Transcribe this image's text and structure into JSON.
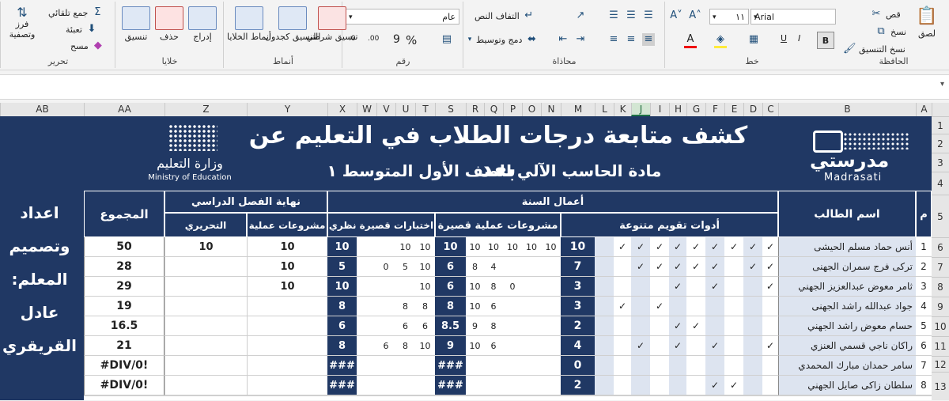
{
  "ribbon": {
    "clipboard": {
      "label": "الحافظة",
      "paste": "لصق",
      "cut": "قص",
      "copy": "نسخ",
      "format_painter": "نسخ التنسيق"
    },
    "font": {
      "label": "خط",
      "name": "Arial",
      "size": "١١",
      "bold": "B",
      "italic": "I",
      "underline": "U"
    },
    "alignment": {
      "label": "محاذاة",
      "wrap": "التفاف النص",
      "merge": "دمج وتوسيط"
    },
    "number": {
      "label": "رقم",
      "format": "عام",
      "percent": "%",
      "comma": "9",
      "inc_dec": ".00",
      "dec_dec": ".0"
    },
    "styles": {
      "label": "أنماط",
      "conditional": "تنسيق شرطي",
      "table": "التنسيق كجدول",
      "cell_styles": "أنماط الخلايا"
    },
    "cells": {
      "label": "خلايا",
      "insert": "إدراج",
      "delete": "حذف",
      "format": "تنسيق"
    },
    "editing": {
      "label": "تحرير",
      "autosum": "جمع تلقائي",
      "fill": "تعبئة",
      "clear": "مسح",
      "sort": "فرز وتصفية"
    }
  },
  "columns": [
    "A",
    "B",
    "C",
    "D",
    "E",
    "F",
    "G",
    "H",
    "I",
    "J",
    "K",
    "L",
    "M",
    "N",
    "O",
    "P",
    "Q",
    "R",
    "S",
    "T",
    "U",
    "V",
    "W",
    "X",
    "Y",
    "Z",
    "AA",
    "AB"
  ],
  "selected_column": "J",
  "rows": [
    "1",
    "2",
    "3",
    "4",
    "5",
    "6",
    "7",
    "8",
    "9",
    "10",
    "11",
    "12",
    "13"
  ],
  "sheet": {
    "title": "كشف متابعة درجات الطلاب في التعليم عن بعد",
    "subtitle": "مادة الحاسب الآلي للصف الأول المتوسط ١",
    "logo_left_ar": "وزارة التعليم",
    "logo_left_en": "Ministry of Education",
    "logo_right_ar": "مدرستي",
    "logo_right_en": "Madrasati",
    "side_note": [
      "اعداد",
      "وتصميم",
      "المعلم:",
      "عادل",
      "القريقري"
    ],
    "headers": {
      "num": "م",
      "student": "اسم الطالب",
      "year_work": "أعمال السنة",
      "tools": "أدوات تقويم متنوعة",
      "projects": "مشروعات عملية قصيرة",
      "quizzes": "اختبارات قصيرة نظري",
      "semester_end": "نهاية الفصل الدراسي",
      "practical": "مشروعات عملية",
      "written": "التحريري",
      "total": "المجموع"
    },
    "students": [
      {
        "num": "1",
        "name": "أنس حماد مسلم الحيشى",
        "checks": [
          "✓",
          "✓",
          "✓",
          "✓",
          "✓",
          "✓",
          "✓",
          "✓",
          "✓"
        ],
        "tools_total": "10",
        "projects": [
          "10",
          "10",
          "10",
          "10",
          "10"
        ],
        "projects_total": "10",
        "quizzes": [
          "10",
          "10",
          "",
          ""
        ],
        "quizzes_total": "10",
        "practical": "10",
        "written": "10",
        "total": "50"
      },
      {
        "num": "2",
        "name": "تركى فرج سمران الجهنى",
        "checks": [
          "✓",
          "✓",
          "",
          "✓",
          "✓",
          "✓",
          "✓",
          "✓",
          ""
        ],
        "tools_total": "7",
        "projects": [
          "8",
          "4",
          "",
          "",
          ""
        ],
        "projects_total": "6",
        "quizzes": [
          "10",
          "5",
          "0",
          ""
        ],
        "quizzes_total": "5",
        "practical": "10",
        "written": "",
        "total": "28"
      },
      {
        "num": "3",
        "name": "ثامر معوض عبدالعزيز الجهني",
        "checks": [
          "✓",
          "",
          "",
          "✓",
          "",
          "✓",
          "",
          "",
          ""
        ],
        "tools_total": "3",
        "projects": [
          "10",
          "8",
          "0",
          "",
          ""
        ],
        "projects_total": "6",
        "quizzes": [
          "10",
          "",
          "",
          ""
        ],
        "quizzes_total": "10",
        "practical": "10",
        "written": "",
        "total": "29"
      },
      {
        "num": "4",
        "name": "جواد عبدالله راشد الجهنى",
        "checks": [
          "",
          "",
          "",
          "",
          "",
          "",
          "✓",
          "",
          "✓"
        ],
        "tools_total": "3",
        "projects": [
          "10",
          "6",
          "",
          "",
          ""
        ],
        "projects_total": "8",
        "quizzes": [
          "8",
          "8",
          "",
          ""
        ],
        "quizzes_total": "8",
        "practical": "",
        "written": "",
        "total": "19"
      },
      {
        "num": "5",
        "name": "حسام معوض راشد الجهني",
        "checks": [
          "",
          "",
          "",
          "",
          "✓",
          "✓",
          "",
          "",
          ""
        ],
        "tools_total": "2",
        "projects": [
          "9",
          "8",
          "",
          "",
          ""
        ],
        "projects_total": "8.5",
        "quizzes": [
          "6",
          "6",
          "",
          ""
        ],
        "quizzes_total": "6",
        "practical": "",
        "written": "",
        "total": "16.5"
      },
      {
        "num": "6",
        "name": "راكان ناجي قسمي العنزي",
        "checks": [
          "✓",
          "",
          "",
          "✓",
          "",
          "✓",
          "",
          "✓",
          ""
        ],
        "tools_total": "4",
        "projects": [
          "10",
          "6",
          "",
          "",
          ""
        ],
        "projects_total": "9",
        "quizzes": [
          "10",
          "8",
          "6",
          ""
        ],
        "quizzes_total": "8",
        "practical": "",
        "written": "",
        "total": "21"
      },
      {
        "num": "7",
        "name": "سامر حمدان مبارك المحمدي",
        "checks": [
          "",
          "",
          "",
          "",
          "",
          "",
          "",
          "",
          ""
        ],
        "tools_total": "0",
        "projects": [
          "",
          "",
          "",
          "",
          ""
        ],
        "projects_total": "###",
        "quizzes": [
          "",
          "",
          "",
          ""
        ],
        "quizzes_total": "###",
        "practical": "",
        "written": "",
        "total": "#DIV/0!"
      },
      {
        "num": "8",
        "name": "سلطان زاكى صايل الجهني",
        "checks": [
          "",
          "",
          "✓",
          "✓",
          "",
          "",
          "",
          "",
          ""
        ],
        "tools_total": "2",
        "projects": [
          "",
          "",
          "",
          "",
          ""
        ],
        "projects_total": "###",
        "quizzes": [
          "",
          "",
          "",
          ""
        ],
        "quizzes_total": "###",
        "practical": "",
        "written": "",
        "total": "#DIV/0!"
      }
    ]
  }
}
